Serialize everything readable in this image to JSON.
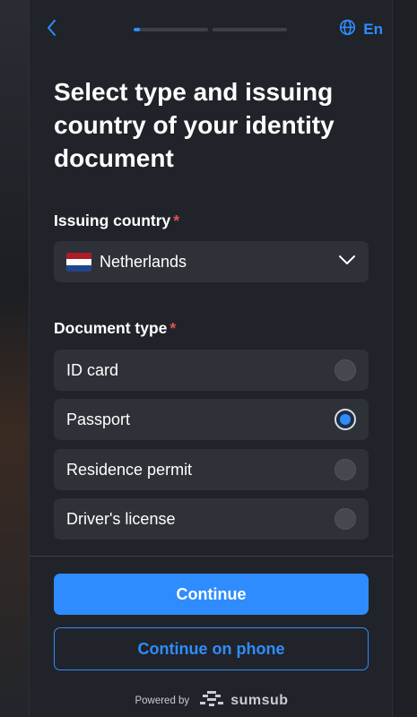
{
  "header": {
    "progress_fraction": [
      0.08,
      0
    ],
    "language": "En"
  },
  "title": "Select type and issuing country of your identity document",
  "issuing_country": {
    "label": "Issuing country",
    "required_mark": "*",
    "selected": "Netherlands",
    "flag_colors": [
      "#ae1c28",
      "#ffffff",
      "#21468b"
    ]
  },
  "document_type": {
    "label": "Document type",
    "required_mark": "*",
    "options": [
      {
        "label": "ID card",
        "selected": false
      },
      {
        "label": "Passport",
        "selected": true
      },
      {
        "label": "Residence permit",
        "selected": false
      },
      {
        "label": "Driver's license",
        "selected": false
      }
    ]
  },
  "actions": {
    "continue_label": "Continue",
    "continue_phone_label": "Continue on phone"
  },
  "footer": {
    "powered_by": "Powered by",
    "brand": "sumsub"
  },
  "colors": {
    "accent": "#2f8cff",
    "required": "#e8504f",
    "background": "#202329",
    "field": "#2e3138"
  }
}
